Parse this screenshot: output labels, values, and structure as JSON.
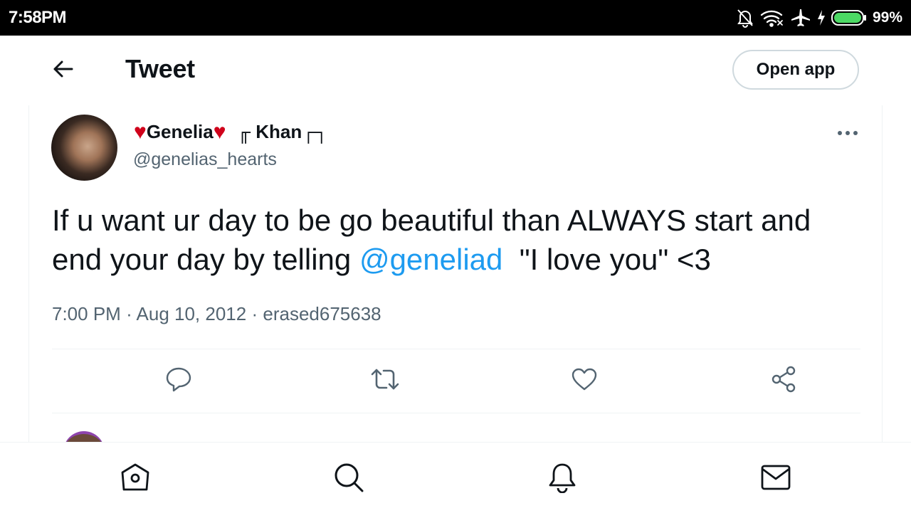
{
  "status_bar": {
    "time": "7:58PM",
    "battery_percent": "99%",
    "icons": [
      "notifications-off-icon",
      "wifi-icon",
      "airplane-icon",
      "charging-icon",
      "battery-icon"
    ]
  },
  "header": {
    "back_icon": "arrow-left-icon",
    "title": "Tweet",
    "open_app_label": "Open app"
  },
  "tweet": {
    "author": {
      "heart_left": "♥",
      "name": "Genelia",
      "heart_right": "♥",
      "name_suffix": "╓ Khan┌┐",
      "handle": "@genelias_hearts"
    },
    "text_before_mention": "If u want ur day to be go beautiful than ALWAYS start and end your day by telling ",
    "mention": "@geneliad",
    "text_after_mention": "  \"I love you\" <3",
    "time": "7:00 PM",
    "separator": "·",
    "date": "Aug 10, 2012",
    "source": "erased675638",
    "more_icon": "more-horizontal-icon"
  },
  "actions": {
    "icons": [
      "reply-icon",
      "retweet-icon",
      "like-icon",
      "share-icon"
    ]
  },
  "bottom_nav": {
    "icons": [
      "home-icon",
      "search-icon",
      "notifications-icon",
      "messages-icon"
    ]
  },
  "colors": {
    "accent": "#1d9bf0",
    "heart": "#d0021b",
    "secondary_text": "#536471",
    "border": "#cfd9de",
    "battery_fill": "#4cd964"
  }
}
